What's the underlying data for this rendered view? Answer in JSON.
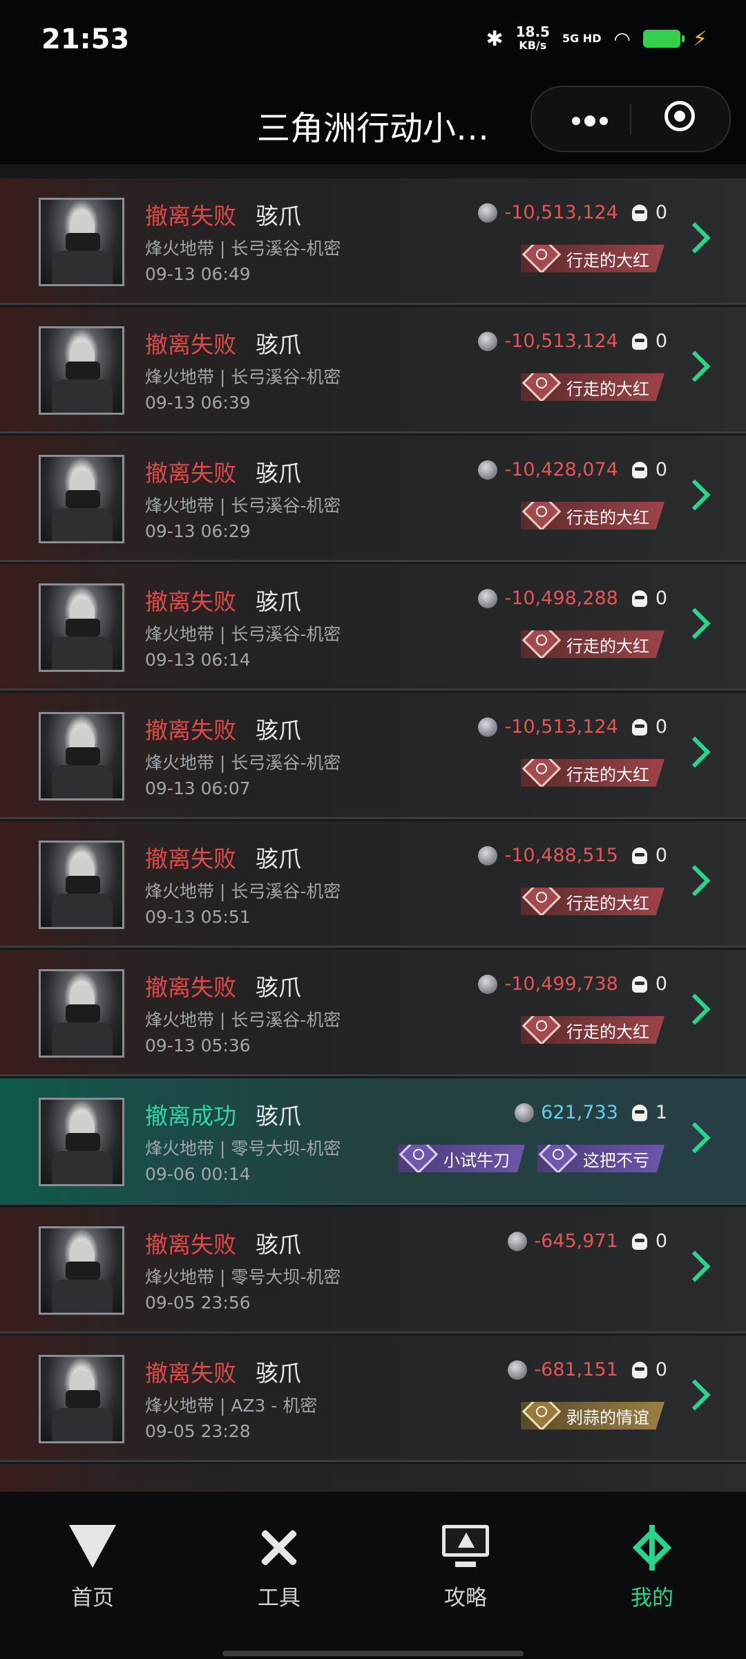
{
  "status_bar": {
    "time": "21:53",
    "speed": "18.5",
    "speed_unit": "KB/s",
    "network": "5G HD"
  },
  "header": {
    "title": "三角洲行动小…"
  },
  "records": [
    {
      "status": "fail",
      "result": "撤离失败",
      "hero": "骇爪",
      "map": "烽火地带 | 长弓溪谷-机密",
      "date": "09-13 06:49",
      "value": "-10,513,124",
      "kills": "0",
      "badges": [
        {
          "label": "行走的大红",
          "style": "red"
        }
      ]
    },
    {
      "status": "fail",
      "result": "撤离失败",
      "hero": "骇爪",
      "map": "烽火地带 | 长弓溪谷-机密",
      "date": "09-13 06:39",
      "value": "-10,513,124",
      "kills": "0",
      "badges": [
        {
          "label": "行走的大红",
          "style": "red"
        }
      ]
    },
    {
      "status": "fail",
      "result": "撤离失败",
      "hero": "骇爪",
      "map": "烽火地带 | 长弓溪谷-机密",
      "date": "09-13 06:29",
      "value": "-10,428,074",
      "kills": "0",
      "badges": [
        {
          "label": "行走的大红",
          "style": "red"
        }
      ]
    },
    {
      "status": "fail",
      "result": "撤离失败",
      "hero": "骇爪",
      "map": "烽火地带 | 长弓溪谷-机密",
      "date": "09-13 06:14",
      "value": "-10,498,288",
      "kills": "0",
      "badges": [
        {
          "label": "行走的大红",
          "style": "red"
        }
      ]
    },
    {
      "status": "fail",
      "result": "撤离失败",
      "hero": "骇爪",
      "map": "烽火地带 | 长弓溪谷-机密",
      "date": "09-13 06:07",
      "value": "-10,513,124",
      "kills": "0",
      "badges": [
        {
          "label": "行走的大红",
          "style": "red"
        }
      ]
    },
    {
      "status": "fail",
      "result": "撤离失败",
      "hero": "骇爪",
      "map": "烽火地带 | 长弓溪谷-机密",
      "date": "09-13 05:51",
      "value": "-10,488,515",
      "kills": "0",
      "badges": [
        {
          "label": "行走的大红",
          "style": "red"
        }
      ]
    },
    {
      "status": "fail",
      "result": "撤离失败",
      "hero": "骇爪",
      "map": "烽火地带 | 长弓溪谷-机密",
      "date": "09-13 05:36",
      "value": "-10,499,738",
      "kills": "0",
      "badges": [
        {
          "label": "行走的大红",
          "style": "red"
        }
      ]
    },
    {
      "status": "success",
      "result": "撤离成功",
      "hero": "骇爪",
      "map": "烽火地带 | 零号大坝-机密",
      "date": "09-06 00:14",
      "value": "621,733",
      "kills": "1",
      "badges": [
        {
          "label": "小试牛刀",
          "style": "purple"
        },
        {
          "label": "这把不亏",
          "style": "purple"
        }
      ]
    },
    {
      "status": "fail",
      "result": "撤离失败",
      "hero": "骇爪",
      "map": "烽火地带 | 零号大坝-机密",
      "date": "09-05 23:56",
      "value": "-645,971",
      "kills": "0",
      "badges": []
    },
    {
      "status": "fail",
      "result": "撤离失败",
      "hero": "骇爪",
      "map": "烽火地带 | AZ3 - 机密",
      "date": "09-05 23:28",
      "value": "-681,151",
      "kills": "0",
      "badges": [
        {
          "label": "剥蒜的情谊",
          "style": "gold"
        }
      ]
    }
  ],
  "tabs": [
    {
      "label": "首页",
      "icon": "home-icon"
    },
    {
      "label": "工具",
      "icon": "tools-icon"
    },
    {
      "label": "攻略",
      "icon": "guide-monitor-icon"
    },
    {
      "label": "我的",
      "icon": "mine-icon",
      "active": true
    }
  ],
  "colors": {
    "fail": "#e0484a",
    "success": "#33d3a6",
    "accent": "#2bd38d"
  }
}
